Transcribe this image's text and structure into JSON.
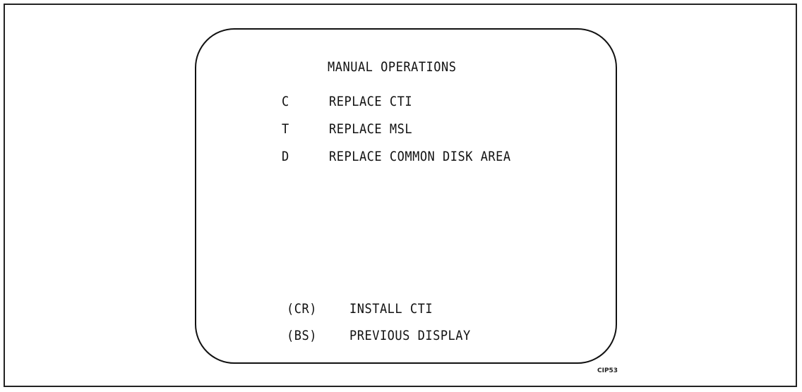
{
  "screen": {
    "title": "MANUAL OPERATIONS",
    "options": [
      {
        "key": "C",
        "label": "REPLACE CTI"
      },
      {
        "key": "T",
        "label": "REPLACE MSL"
      },
      {
        "key": "D",
        "label": "REPLACE COMMON DISK AREA"
      }
    ],
    "footer": [
      {
        "key": "(CR)",
        "label": "INSTALL CTI"
      },
      {
        "key": "(BS)",
        "label": "PREVIOUS DISPLAY"
      }
    ]
  },
  "figure_id": "CIP53"
}
